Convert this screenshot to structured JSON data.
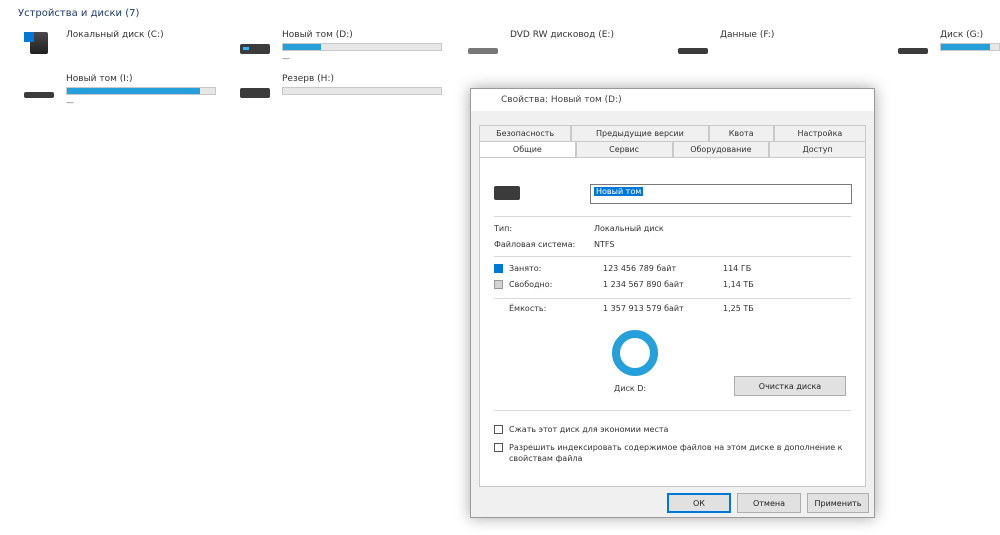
{
  "section_title": "Устройства и диски (7)",
  "drives": [
    {
      "name": "Локальный диск (C:)",
      "used_fraction": 0.0,
      "free": ""
    },
    {
      "name": "Новый том (D:)",
      "used_fraction": 0.24,
      "free": "—"
    },
    {
      "name": "DVD RW дисковод (E:)",
      "used_fraction": 0.0,
      "free": ""
    },
    {
      "name": "Данные (F:)",
      "used_fraction": 0.0,
      "free": ""
    },
    {
      "name": "Диск (G:)",
      "used_fraction": 0.85,
      "free": "—"
    },
    {
      "name": "Резерв (H:)",
      "used_fraction": 0.0,
      "free": ""
    },
    {
      "name": "Новый том (I:)",
      "used_fraction": 0.9,
      "free": "—"
    }
  ],
  "dialog": {
    "title": "Свойства: Новый том (D:)",
    "tabs_top": [
      "Безопасность",
      "Предыдущие версии",
      "Квота",
      "Настройка"
    ],
    "tabs_bottom": [
      "Общие",
      "Сервис",
      "Оборудование",
      "Доступ"
    ],
    "name_value": "Новый том",
    "type_label": "Тип:",
    "type_value": "Локальный диск",
    "fs_label": "Файловая система:",
    "fs_value": "NTFS",
    "used_label": "Занято:",
    "used_bytes": "123 456 789 байт",
    "used_gb": "114 ГБ",
    "free_label": "Свободно:",
    "free_bytes": "1 234 567 890 байт",
    "free_gb": "1,14 ТБ",
    "capacity_label": "Ёмкость:",
    "capacity_bytes": "1 357 913 579 байт",
    "capacity_gb": "1,25 ТБ",
    "disk_label": "Диск D:",
    "cleanup_button": "Очистка диска",
    "compress_label": "Сжать этот диск для экономии места",
    "index_label": "Разрешить индексировать содержимое файлов на этом диске в дополнение к свойствам файла",
    "ok": "ОК",
    "cancel": "Отмена",
    "apply": "Применить"
  },
  "colors": {
    "accent": "#26a0da",
    "used": "#0078d7",
    "free": "#d3d3d3"
  },
  "icons": [
    "windows-drive-icon",
    "hdd-icon",
    "dvd-icon",
    "usb-drive-icon"
  ]
}
